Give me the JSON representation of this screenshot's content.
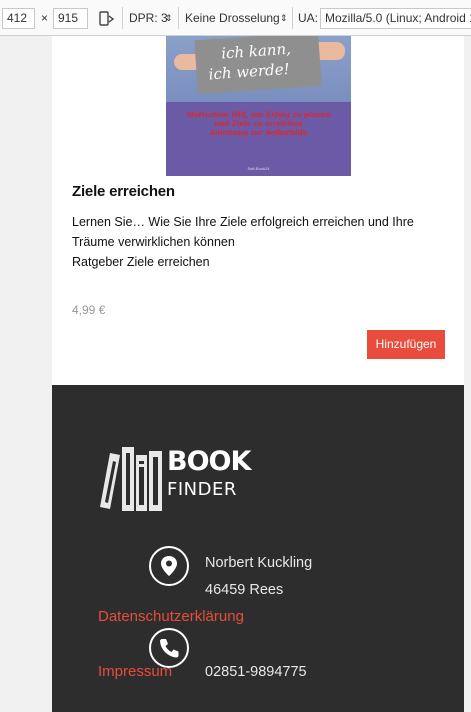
{
  "devtools": {
    "width": "412",
    "times": "×",
    "height": "915",
    "dpr": "DPR: 3",
    "throttle": "Keine Drosselung",
    "ua_label": "UA:",
    "ua_value": "Mozilla/5.0 (Linux; Android 1"
  },
  "product": {
    "cover": {
      "sign_line1": "ich kann,",
      "sign_line2": "ich werde!",
      "red_text_1": "Motivation Hilf, um Erfolg zu planen",
      "red_text_2": "und Ziele zu erreichen",
      "red_text_3": "Anleitung zur Selbsthilfe",
      "footer": "Soft-Book24"
    },
    "title": "Ziele erreichen",
    "description_line1": "Lernen Sie… Wie Sie Ihre Ziele erfolgreich erreichen und Ihre",
    "description_line2": "Träume verwirklichen können",
    "description_line3": "Ratgeber Ziele erreichen",
    "price": "4,99 €",
    "add_button": "Hinzufügen"
  },
  "footer": {
    "logo_book": "BOOK",
    "logo_finder": "FINDER",
    "address_name": "Norbert Kuckling",
    "address_city": "46459 Rees",
    "privacy_link": "Datenschutzerklärung",
    "imprint_link": "Impressum",
    "phone": "02851-9894775"
  },
  "colors": {
    "accent": "#e74c3c",
    "footer_bg": "#2d2d2d"
  },
  "icons": {
    "rotate": "rotate-device-icon",
    "location": "map-pin-icon",
    "phone": "phone-icon"
  }
}
